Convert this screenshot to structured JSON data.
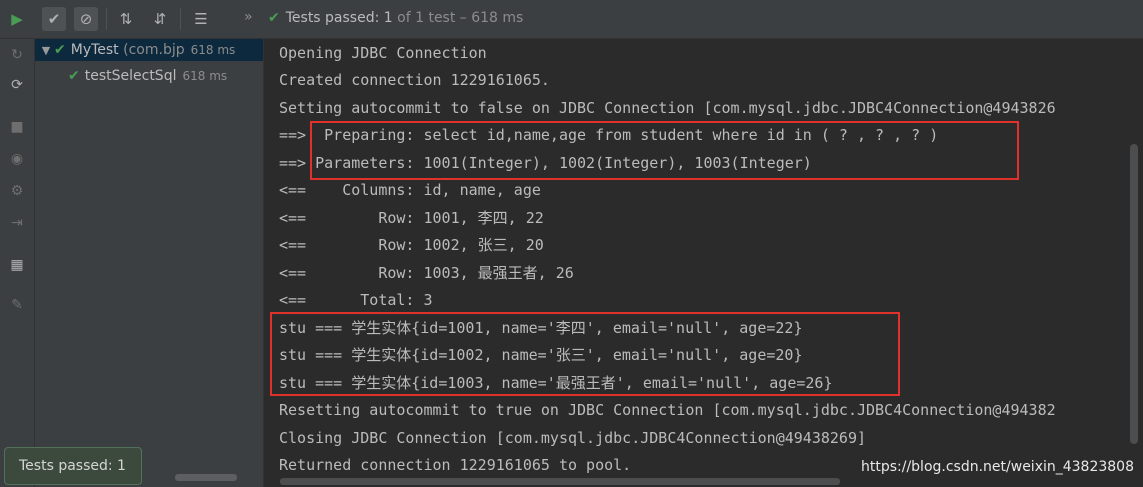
{
  "toolbar": {
    "buttons": [
      {
        "icon": "run-icon",
        "glyph": "▶"
      },
      {
        "icon": "show-passed-icon",
        "glyph": "✔"
      },
      {
        "icon": "show-ignored-icon",
        "glyph": "⊘"
      },
      {
        "icon": "sort-alpha-icon",
        "glyph": "⇅"
      },
      {
        "icon": "sort-duration-icon",
        "glyph": "⇵"
      },
      {
        "icon": "expand-all-icon",
        "glyph": "☰"
      }
    ],
    "more_glyph": "»",
    "status_prefix": "Tests passed:",
    "status_count": "1",
    "status_suffix": "of 1 test – 618 ms"
  },
  "leftbar": {
    "icons": [
      {
        "icon": "rerun-failed-icon",
        "glyph": "↻"
      },
      {
        "icon": "toggle-autotest-icon",
        "glyph": "⟳"
      },
      {
        "icon": "stop-icon",
        "glyph": "■"
      },
      {
        "icon": "camera-icon",
        "glyph": "◉"
      },
      {
        "icon": "settings-icon",
        "glyph": "⚙"
      },
      {
        "icon": "import-icon",
        "glyph": "⇥"
      },
      {
        "icon": "layout-icon",
        "glyph": "▦"
      },
      {
        "icon": "pin-icon",
        "glyph": "✎"
      }
    ]
  },
  "tree": {
    "root": {
      "name": "MyTest",
      "pkg": "(com.bjp",
      "time": "618 ms"
    },
    "child": {
      "name": "testSelectSql",
      "time": "618 ms"
    }
  },
  "toast": {
    "text": "Tests passed: 1"
  },
  "console": {
    "lines": [
      "Opening JDBC Connection",
      "Created connection 1229161065.",
      "Setting autocommit to false on JDBC Connection [com.mysql.jdbc.JDBC4Connection@4943826",
      "==>  Preparing: select id,name,age from student where id in ( ? , ? , ? )",
      "==> Parameters: 1001(Integer), 1002(Integer), 1003(Integer)",
      "<==    Columns: id, name, age",
      "<==        Row: 1001, 李四, 22",
      "<==        Row: 1002, 张三, 20",
      "<==        Row: 1003, 最强王者, 26",
      "<==      Total: 3",
      "stu === 学生实体{id=1001, name='李四', email='null', age=22}",
      "stu === 学生实体{id=1002, name='张三', email='null', age=20}",
      "stu === 学生实体{id=1003, name='最强王者', email='null', age=26}",
      "Resetting autocommit to true on JDBC Connection [com.mysql.jdbc.JDBC4Connection@494382",
      "Closing JDBC Connection [com.mysql.jdbc.JDBC4Connection@49438269]",
      "Returned connection 1229161065 to pool."
    ],
    "watermark": "https://blog.csdn.net/weixin_43823808"
  },
  "colors": {
    "pass_green": "#499c54",
    "highlight_red": "#e0312c",
    "run_green": "#499c54"
  }
}
